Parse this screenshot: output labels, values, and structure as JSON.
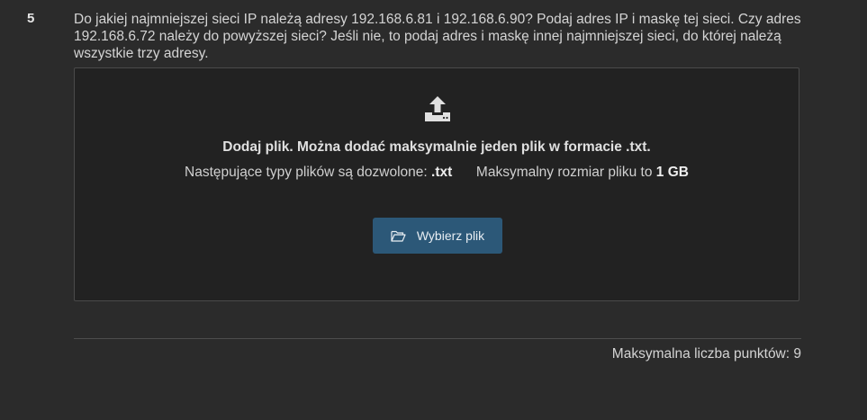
{
  "question": {
    "number": "5",
    "text": "Do jakiej najmniejszej sieci IP należą adresy 192.168.6.81 i 192.168.6.90? Podaj adres IP i maskę tej sieci. Czy adres 192.168.6.72 należy do powyższej sieci? Jeśli nie, to podaj adres i maskę innej najmniejszej sieci, do której należą wszystkie trzy adresy."
  },
  "upload": {
    "icon": "upload-icon",
    "title": "Dodaj plik. Można dodać maksymalnie jeden plik w formacie .txt.",
    "allowed_label": "Następujące typy plików są dozwolone:",
    "allowed_types": ".txt",
    "max_size_label": "Maksymalny rozmiar pliku to",
    "max_size_value": "1 GB",
    "button_icon": "folder-open-icon",
    "button_label": "Wybierz plik"
  },
  "footer": {
    "max_points": "Maksymalna liczba punktów: 9"
  },
  "colors": {
    "background": "#2b2b2b",
    "dropzone": "#222222",
    "button": "#2c5878"
  }
}
